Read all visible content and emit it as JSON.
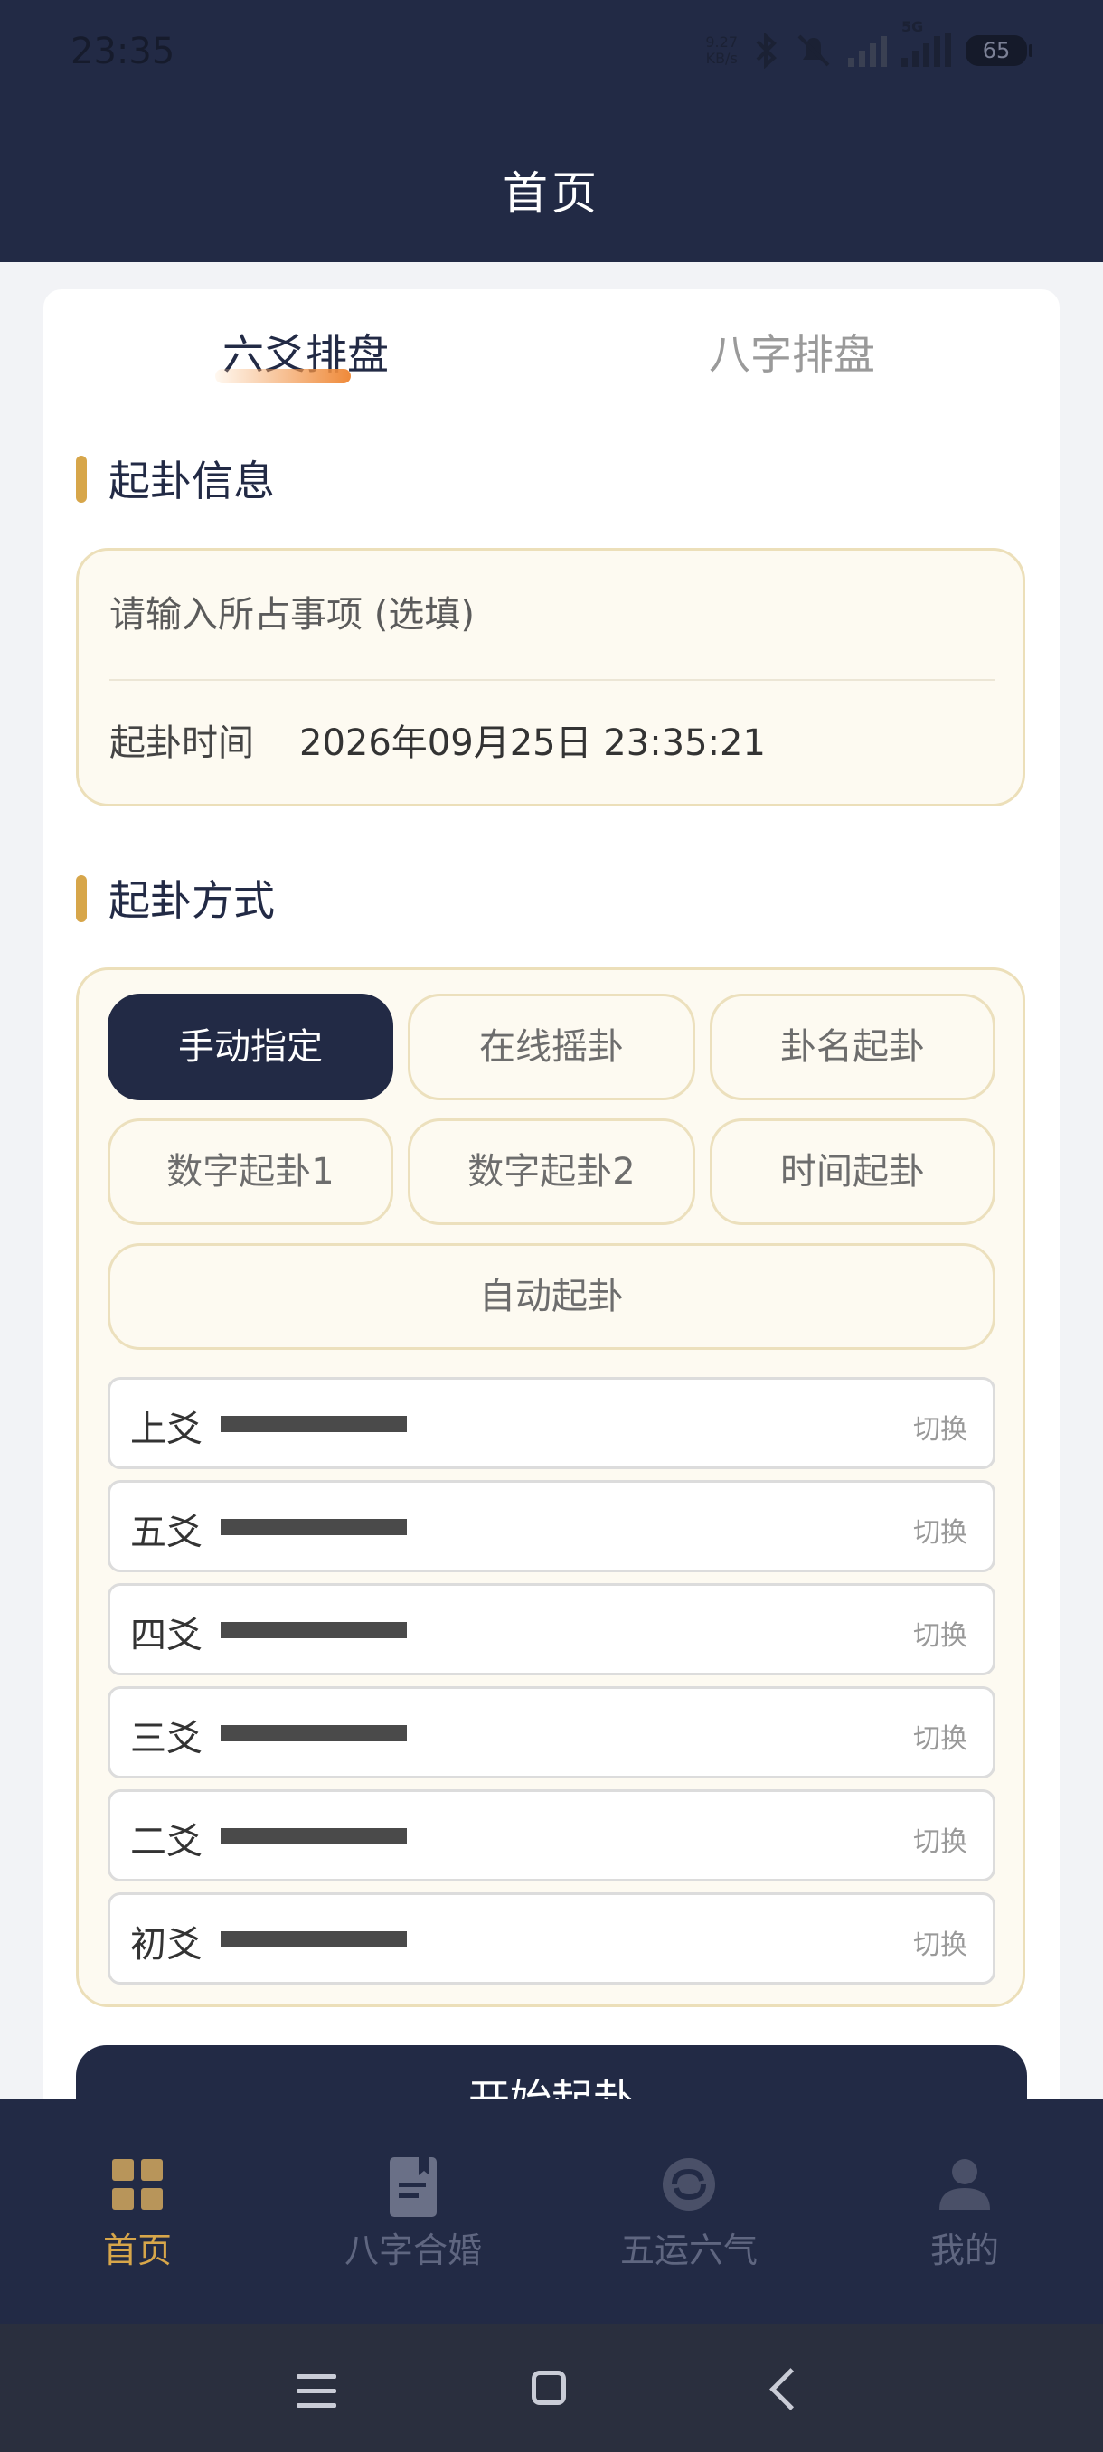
{
  "status_bar": {
    "time": "23:35",
    "net_speed_value": "9.27",
    "net_speed_unit": "KB/s",
    "network_type": "5G",
    "battery": "65"
  },
  "header": {
    "title": "首页"
  },
  "tabs": {
    "liuyao": "六爻排盘",
    "bazi": "八字排盘",
    "active": "liuyao"
  },
  "info_section": {
    "title": "起卦信息",
    "input_placeholder": "请输入所占事项 (选填)",
    "time_label": "起卦时间",
    "time_value": "2026年09月25日 23:35:21"
  },
  "method_section": {
    "title": "起卦方式",
    "methods": [
      "手动指定",
      "在线摇卦",
      "卦名起卦",
      "数字起卦1",
      "数字起卦2",
      "时间起卦",
      "自动起卦"
    ],
    "active_method": "手动指定"
  },
  "yao_rows": [
    {
      "name": "上爻",
      "switch": "切换"
    },
    {
      "name": "五爻",
      "switch": "切换"
    },
    {
      "name": "四爻",
      "switch": "切换"
    },
    {
      "name": "三爻",
      "switch": "切换"
    },
    {
      "name": "二爻",
      "switch": "切换"
    },
    {
      "name": "初爻",
      "switch": "切换"
    }
  ],
  "start_button": {
    "label": "开始起卦"
  },
  "bottom_tabs": [
    {
      "label": "首页",
      "icon": "grid-icon",
      "active": true
    },
    {
      "label": "八字合婚",
      "icon": "book-icon",
      "active": false
    },
    {
      "label": "五运六气",
      "icon": "cycle-icon",
      "active": false
    },
    {
      "label": "我的",
      "icon": "user-icon",
      "active": false
    }
  ],
  "colors": {
    "navy": "#222a45",
    "gold": "#d7a64a",
    "cream": "#fdfaf1",
    "accent_orange": "#ef8a3a"
  }
}
